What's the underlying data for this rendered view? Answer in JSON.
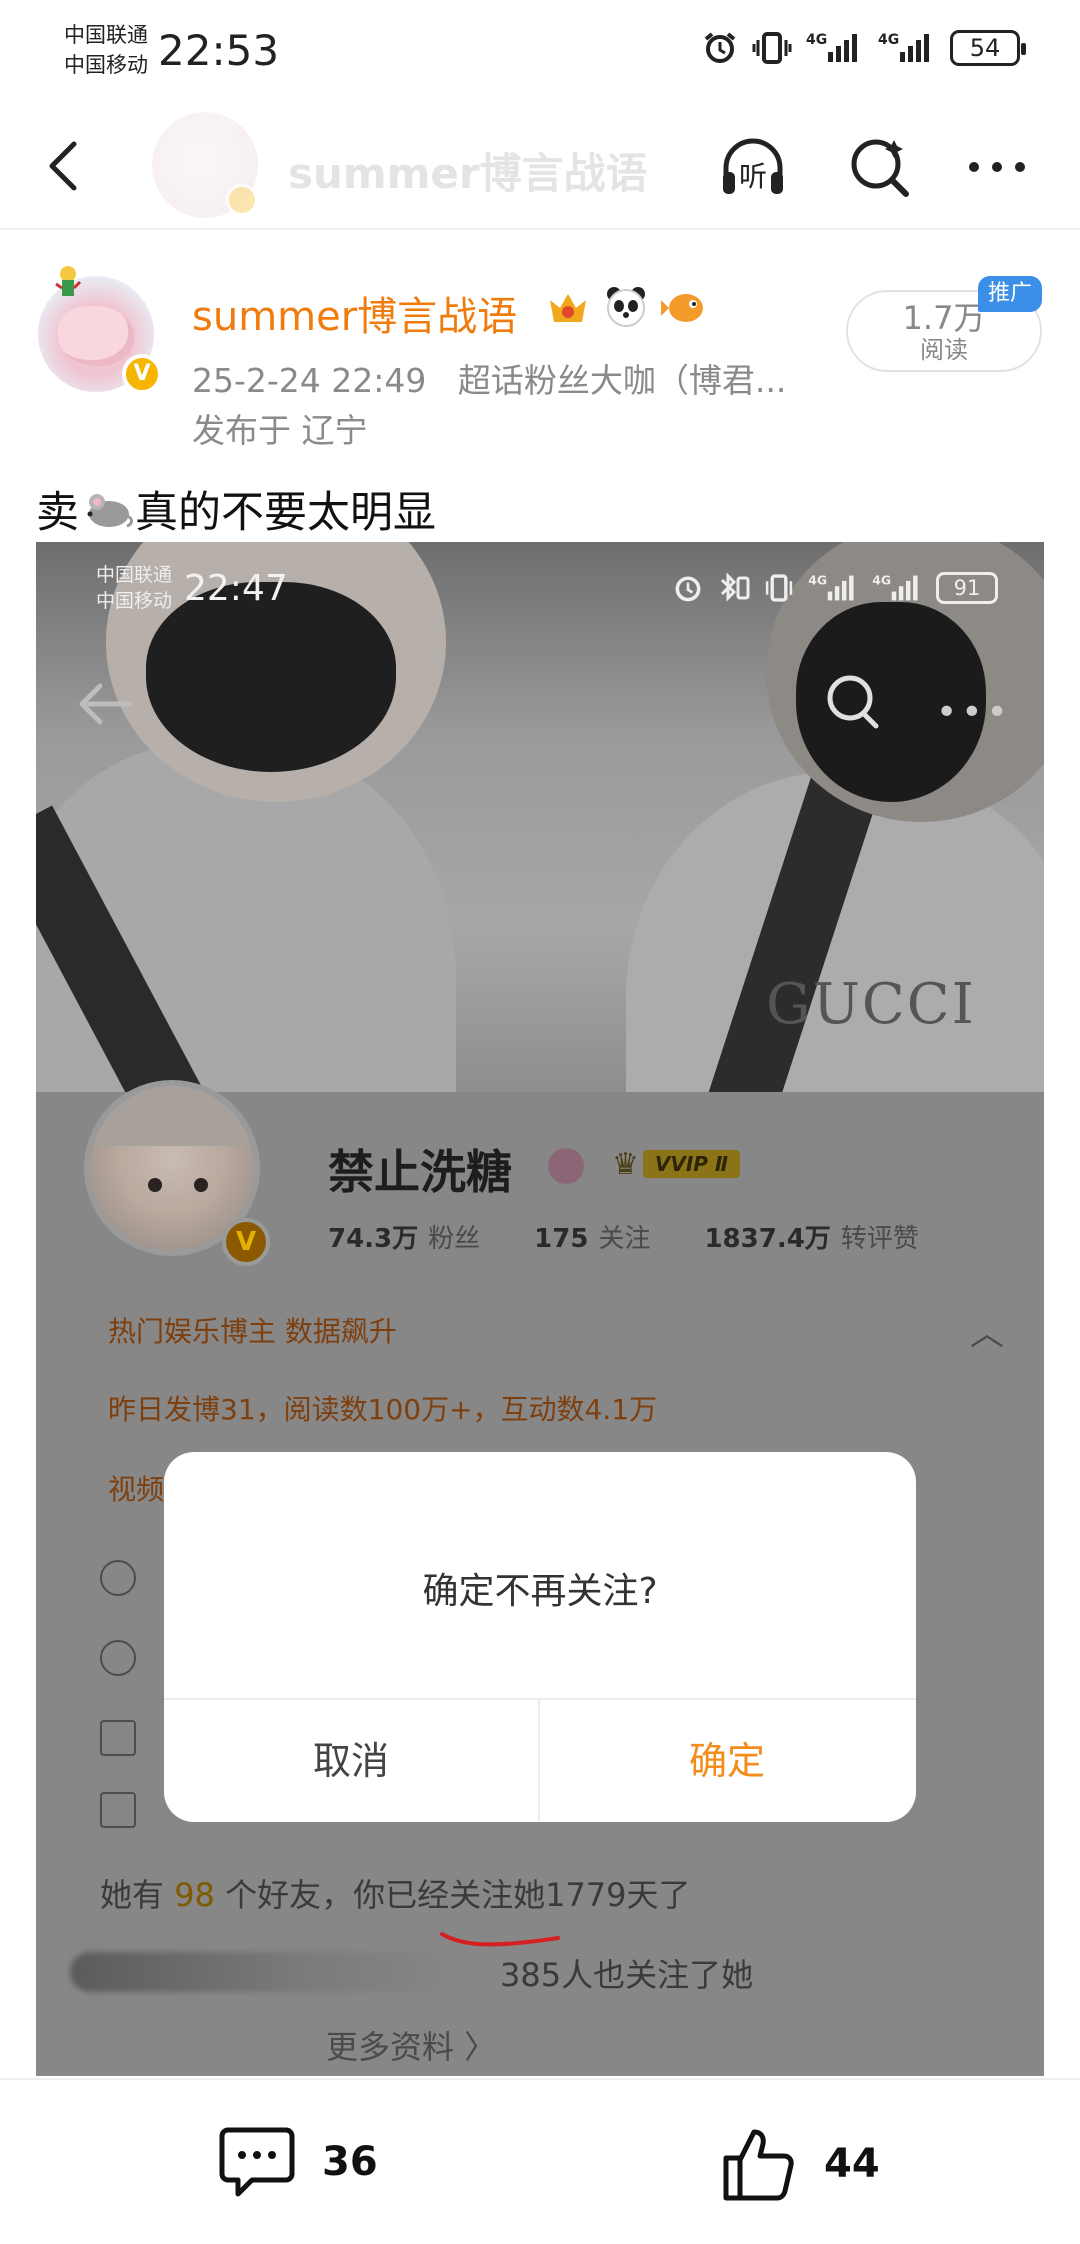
{
  "status_bar": {
    "carrier_1": "中国联通",
    "carrier_2": "中国移动",
    "time": "22:53",
    "battery": "54"
  },
  "nav": {
    "title": "summer博言战语",
    "icons": [
      "back-icon",
      "listen-icon",
      "search-icon",
      "more-icon"
    ],
    "listen_label": "听"
  },
  "post": {
    "author": "summer博言战语",
    "author_badges": [
      "crown-badge-icon",
      "panda-icon",
      "fish-icon"
    ],
    "time": "25-2-24 22:49",
    "source": "超话粉丝大咖（博君...",
    "location": "发布于 辽宁",
    "reads_count": "1.7万",
    "reads_label": "阅读",
    "promo_tag": "推广",
    "text_before": "卖",
    "text_after": "真的不要太明显"
  },
  "embedded": {
    "status": {
      "carrier_1": "中国联通",
      "carrier_2": "中国移动",
      "time": "22:47",
      "battery": "91"
    },
    "gucci_text": "GUCCI",
    "profile": {
      "name": "禁止洗糖",
      "vip": "VVIP Ⅱ",
      "verified_badge": "V",
      "fans_value": "74.3万",
      "fans_label": "粉丝",
      "following_value": "175",
      "following_label": "关注",
      "interactions_value": "1837.4万",
      "interactions_label": "转评赞",
      "hot_title": "热门娱乐博主 数据飙升",
      "hot_detail": "昨日发博31，阅读数100万+，互动数4.1万",
      "hot_line3": "视频",
      "friends_pre": "她有 ",
      "friends_count": "98",
      "friends_post": " 个好友，你已经关注她1779天了",
      "also_follow": "385人也关注了她",
      "more_info": "更多资料 〉"
    }
  },
  "dialog": {
    "message": "确定不再关注?",
    "cancel": "取消",
    "confirm": "确定"
  },
  "bottom": {
    "comments": "36",
    "likes": "44"
  }
}
